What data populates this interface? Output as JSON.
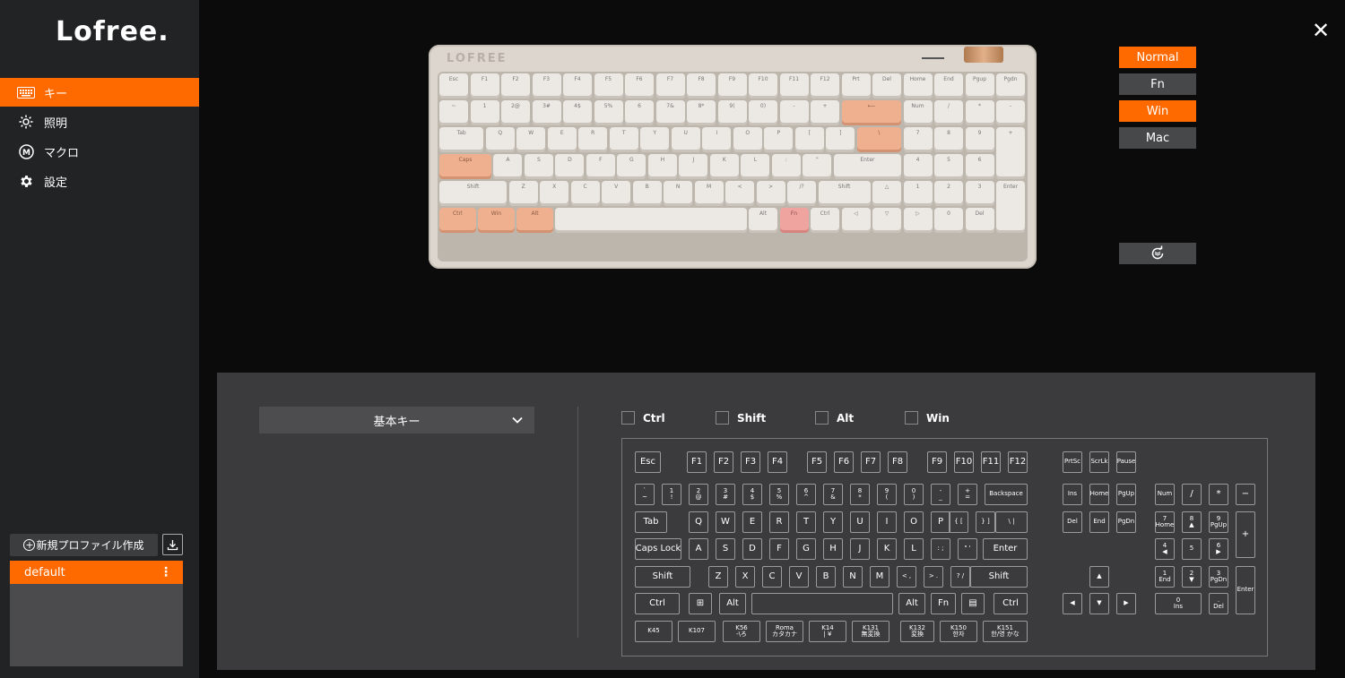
{
  "brand": "Lofree.",
  "sidebar": {
    "nav": [
      {
        "label": "キー",
        "icon": "keyboard-icon",
        "active": true
      },
      {
        "label": "照明",
        "icon": "sun-icon",
        "active": false
      },
      {
        "label": "マクロ",
        "icon": "macro-m-icon",
        "active": false
      },
      {
        "label": "設定",
        "icon": "gear-icon",
        "active": false
      }
    ],
    "new_profile_label": "新規プロファイル作成",
    "profiles": [
      {
        "name": "default",
        "active": true
      }
    ]
  },
  "keyboard_photo": {
    "brand": "LOFREE",
    "rows": [
      [
        "Esc",
        "F1",
        "F2",
        "F3",
        "F4",
        "F5",
        "F6",
        "F7",
        "F8",
        "F9",
        "F10",
        "F11",
        "F12",
        "Prt",
        "Del",
        "Home",
        "End",
        "Pgup",
        "Pgdn"
      ],
      [
        "~",
        "1",
        "2@",
        "3#",
        "4$",
        "5%",
        "6",
        "7&",
        "8*",
        "9(",
        "0)",
        "-",
        "+",
        "⟵",
        "Num",
        "/",
        "*",
        "-"
      ],
      [
        "Tab",
        "Q",
        "W",
        "E",
        "R",
        "T",
        "Y",
        "U",
        "I",
        "O",
        "P",
        "[",
        "]",
        "\\",
        "7",
        "8",
        "9",
        "+"
      ],
      [
        "Caps",
        "A",
        "S",
        "D",
        "F",
        "G",
        "H",
        "J",
        "K",
        "L",
        ":",
        "\"",
        "Enter",
        "4",
        "5",
        "6"
      ],
      [
        "Shift",
        "Z",
        "X",
        "C",
        "V",
        "B",
        "N",
        "M",
        "<",
        ">",
        "/?",
        "Shift",
        "△",
        "1",
        "2",
        "3",
        "Enter"
      ],
      [
        "Ctrl",
        "Win",
        "Alt",
        "",
        "Alt",
        "Fn",
        "Ctrl",
        "◁",
        "▽",
        "▷",
        "0",
        "Del"
      ]
    ]
  },
  "modes": [
    {
      "label": "Normal",
      "active": true
    },
    {
      "label": "Fn",
      "active": false
    },
    {
      "label": "Win",
      "active": true
    },
    {
      "label": "Mac",
      "active": false
    }
  ],
  "key_type_select": {
    "value": "基本キー"
  },
  "modifiers": [
    "Ctrl",
    "Shift",
    "Alt",
    "Win"
  ],
  "virtual_keyboard": {
    "fn_row": [
      "Esc",
      "F1",
      "F2",
      "F3",
      "F4",
      "F5",
      "F6",
      "F7",
      "F8",
      "F9",
      "F10",
      "F11",
      "F12"
    ],
    "nav_top": [
      "PrtSc",
      "ScrLk",
      "Pause"
    ],
    "num_row": [
      [
        "`",
        "~"
      ],
      [
        "1",
        "!"
      ],
      [
        "2",
        "@"
      ],
      [
        "3",
        "#"
      ],
      [
        "4",
        "$"
      ],
      [
        "5",
        "%"
      ],
      [
        "6",
        "^"
      ],
      [
        "7",
        "&"
      ],
      [
        "8",
        "*"
      ],
      [
        "9",
        "("
      ],
      [
        "0",
        ")"
      ],
      [
        "-",
        "_"
      ],
      [
        "+",
        "="
      ],
      [
        "Backspace",
        ""
      ]
    ],
    "tab_row": [
      "Tab",
      "Q",
      "W",
      "E",
      "R",
      "T",
      "Y",
      "U",
      "I",
      "O",
      "P",
      "{ [",
      "} ]",
      "\\ |"
    ],
    "caps_row": [
      "Caps Lock",
      "A",
      "S",
      "D",
      "F",
      "G",
      "H",
      "J",
      "K",
      "L",
      ": ;",
      "\" '",
      "Enter"
    ],
    "shift_row": [
      "Shift",
      "Z",
      "X",
      "C",
      "V",
      "B",
      "N",
      "M",
      "< ,",
      "> .",
      "? /",
      "Shift"
    ],
    "ctrl_row": [
      "Ctrl",
      "⊞",
      "Alt",
      "",
      "Alt",
      "Fn",
      "▤",
      "Ctrl"
    ],
    "extra_row": [
      [
        "K45",
        ""
      ],
      [
        "K107",
        ""
      ],
      [
        "K56",
        "-\\ろ"
      ],
      [
        "Roma",
        "カタカナ"
      ],
      [
        "K14",
        "| ¥"
      ],
      [
        "K131",
        "無変換"
      ],
      [
        "K132",
        "変換"
      ],
      [
        "K150",
        "한자"
      ],
      [
        "K151",
        "한/영 かな"
      ]
    ],
    "nav_mid": [
      "Ins",
      "Home",
      "PgUp",
      "Del",
      "End",
      "PgDn"
    ],
    "arrows": [
      "▲",
      "◀",
      "▼",
      "▶"
    ],
    "numpad": [
      [
        "Num",
        ""
      ],
      [
        "/",
        ""
      ],
      [
        "*",
        ""
      ],
      [
        "−",
        ""
      ],
      [
        "7",
        "Home"
      ],
      [
        "8",
        "▲"
      ],
      [
        "9",
        "PgUp"
      ],
      [
        "+",
        ""
      ],
      [
        "4",
        "◀"
      ],
      [
        "5",
        ""
      ],
      [
        "6",
        "▶"
      ],
      [
        "1",
        "End"
      ],
      [
        "2",
        "▼"
      ],
      [
        "3",
        "PgDn"
      ],
      [
        "Enter",
        ""
      ],
      [
        "0",
        "Ins"
      ],
      [
        ".",
        "Del"
      ]
    ]
  },
  "colors": {
    "accent": "#ff6a00",
    "sidebar_bg": "#222325",
    "panel_bg": "#3b3b3d"
  }
}
